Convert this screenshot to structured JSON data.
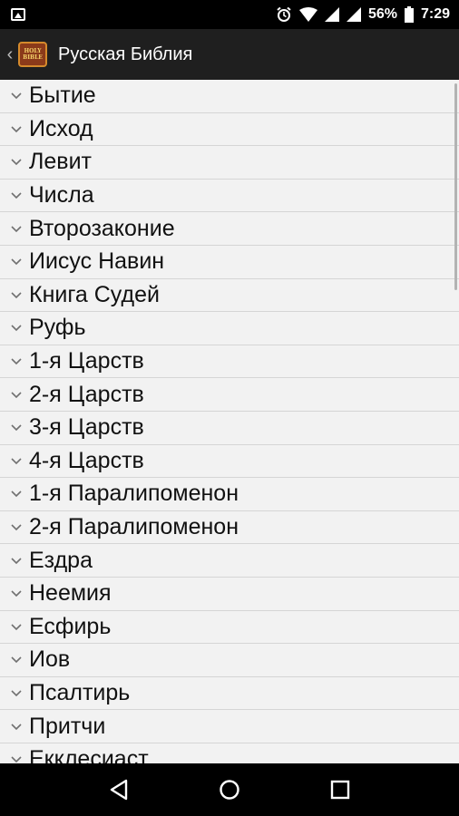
{
  "status_bar": {
    "battery_percent": "56%",
    "time": "7:29",
    "icons": [
      "image-icon",
      "alarm-icon",
      "wifi-icon",
      "signal-icon",
      "battery-icon"
    ]
  },
  "app_bar": {
    "title": "Русская Библия",
    "logo_text": "HOLY BIBLE"
  },
  "books": [
    {
      "label": "Бытие"
    },
    {
      "label": "Исход"
    },
    {
      "label": "Левит"
    },
    {
      "label": "Числа"
    },
    {
      "label": "Второзаконие"
    },
    {
      "label": "Иисус Навин"
    },
    {
      "label": "Книга Судей"
    },
    {
      "label": "Руфь"
    },
    {
      "label": "1-я Царств"
    },
    {
      "label": "2-я Царств"
    },
    {
      "label": "3-я Царств"
    },
    {
      "label": "4-я Царств"
    },
    {
      "label": "1-я Паралипоменон"
    },
    {
      "label": "2-я Паралипоменон"
    },
    {
      "label": "Ездра"
    },
    {
      "label": "Неемия"
    },
    {
      "label": "Есфирь"
    },
    {
      "label": "Иов"
    },
    {
      "label": "Псалтирь"
    },
    {
      "label": "Притчи"
    },
    {
      "label": "Екклесиаст"
    }
  ],
  "nav_bar": {
    "icons": [
      "back-icon",
      "home-icon",
      "recents-icon"
    ]
  }
}
